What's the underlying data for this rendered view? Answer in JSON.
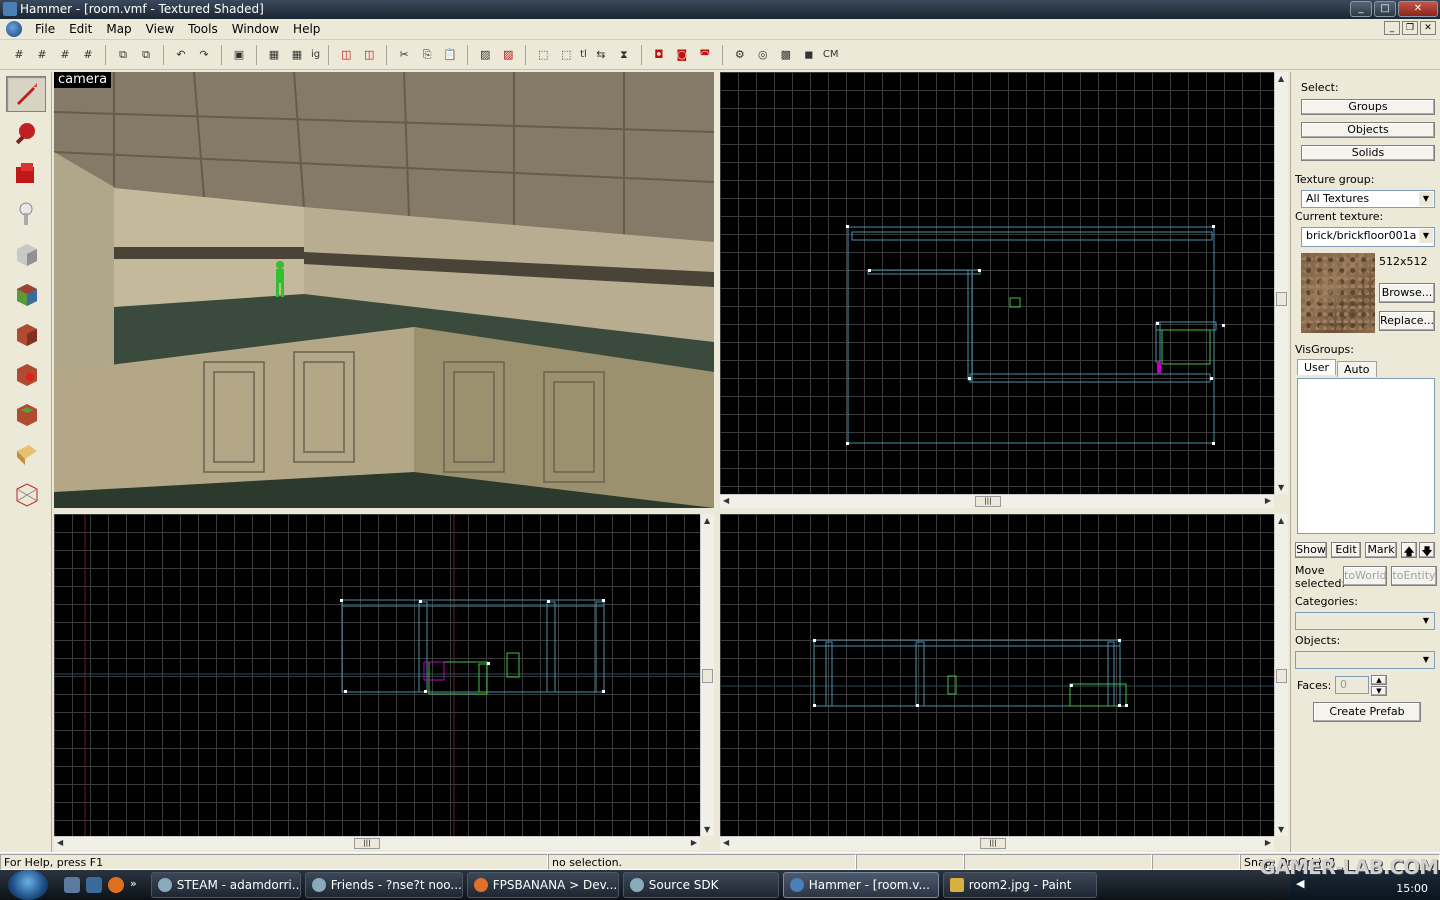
{
  "window": {
    "title": "Hammer - [room.vmf - Textured Shaded]"
  },
  "menu": [
    "File",
    "Edit",
    "Map",
    "View",
    "Tools",
    "Window",
    "Help"
  ],
  "toolbar": {
    "cordon_text": "CM",
    "ig_text": "ig",
    "tl_text": "tl"
  },
  "camera": {
    "label": "camera"
  },
  "right_panel": {
    "select_label": "Select:",
    "groups_btn": "Groups",
    "objects_btn": "Objects",
    "solids_btn": "Solids",
    "texture_group_label": "Texture group:",
    "texture_group_value": "All Textures",
    "current_texture_label": "Current texture:",
    "current_texture_value": "brick/brickfloor001a",
    "texture_size": "512x512",
    "browse_btn": "Browse...",
    "replace_btn": "Replace...",
    "visgroups_label": "VisGroups:",
    "tab_user": "User",
    "tab_auto": "Auto",
    "show_btn": "Show",
    "edit_btn": "Edit",
    "mark_btn": "Mark",
    "move_selected_label_1": "Move",
    "move_selected_label_2": "selected:",
    "toworld_btn": "toWorld",
    "toentity_btn": "toEntity",
    "categories_label": "Categories:",
    "objects_label": "Objects:",
    "faces_label": "Faces:",
    "faces_value": "0",
    "create_prefab_btn": "Create Prefab"
  },
  "status": {
    "help": "For Help, press F1",
    "selection": "no selection.",
    "snap": "Snap: On Grid: 8"
  },
  "taskbar": {
    "tasks": [
      {
        "label": "STEAM - adamdorri...",
        "color": "#8ab"
      },
      {
        "label": "Friends - ?nse?t noo...",
        "color": "#8ab"
      },
      {
        "label": "FPSBANANA > Dev...",
        "color": "#e0702a"
      },
      {
        "label": "Source SDK",
        "color": "#8ab"
      },
      {
        "label": "Hammer - [room.v...",
        "color": "#4a7fb6"
      },
      {
        "label": "room2.jpg - Paint",
        "color": "#d8b040"
      }
    ],
    "clock": "15:00"
  },
  "watermark": "GAMER-LAB.COM",
  "colors": {
    "grid_line": "#3a3a3a",
    "brush_outline": "#4a90a8",
    "entity_outline": "#40c040",
    "vertex": "#ffffff",
    "selected_accent": "#c000c0"
  }
}
